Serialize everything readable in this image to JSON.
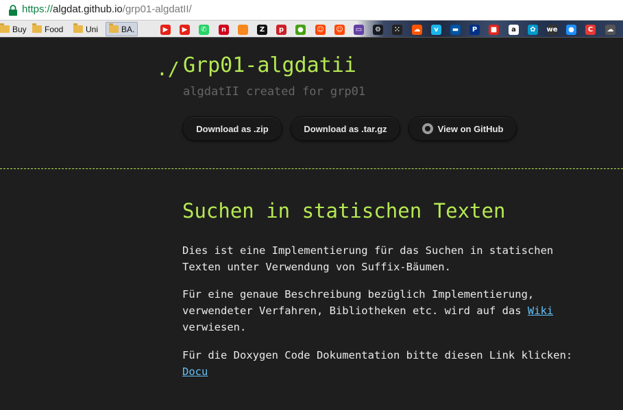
{
  "browser": {
    "url_protocol": "https://",
    "url_host": "algdat.github.io",
    "url_path": "/grp01-algdatII/",
    "bookmarks": [
      {
        "label": "Buy"
      },
      {
        "label": "Food"
      },
      {
        "label": "Uni"
      },
      {
        "label": "BA."
      }
    ],
    "bookmark_icons": [
      {
        "name": "youtube-icon",
        "color": "#e62117",
        "glyph": "▶"
      },
      {
        "name": "youtube-icon",
        "color": "#e62117",
        "glyph": "▶"
      },
      {
        "name": "whatsapp-icon",
        "color": "#25d366",
        "glyph": "✆"
      },
      {
        "name": "n-icon",
        "color": "#d0021b",
        "glyph": "n"
      },
      {
        "name": "orange-square-icon",
        "color": "#f6881f",
        "glyph": ""
      },
      {
        "name": "z-icon",
        "color": "#111111",
        "glyph": "Z"
      },
      {
        "name": "pinterest-icon",
        "color": "#cb2027",
        "glyph": "p"
      },
      {
        "name": "green-dot-icon",
        "color": "#46a012",
        "glyph": "●"
      },
      {
        "name": "reddit-icon",
        "color": "#ff4500",
        "glyph": "☺"
      },
      {
        "name": "reddit-icon",
        "color": "#ff4500",
        "glyph": "☺"
      },
      {
        "name": "twitch-icon",
        "color": "#6441a5",
        "glyph": "▭"
      },
      {
        "name": "steam-icon",
        "color": "#171a21",
        "glyph": "⚙"
      },
      {
        "name": "dots-icon",
        "color": "#222222",
        "glyph": "⁙"
      },
      {
        "name": "soundcloud-icon",
        "color": "#ff5500",
        "glyph": "☁"
      },
      {
        "name": "vimeo-icon",
        "color": "#1ab7ea",
        "glyph": "v"
      },
      {
        "name": "bank-icon",
        "color": "#0054a6",
        "glyph": "▬"
      },
      {
        "name": "paypal-icon",
        "color": "#003087",
        "glyph": "P"
      },
      {
        "name": "colorful-icon",
        "color": "#e1251b",
        "glyph": "■"
      },
      {
        "name": "amazon-icon",
        "color": "#ffffff",
        "glyph": "a"
      },
      {
        "name": "clover-icon",
        "color": "#0099cc",
        "glyph": "✿"
      },
      {
        "name": "we-icon",
        "color": "#333333",
        "glyph": "we"
      },
      {
        "name": "cloud-icon",
        "color": "#1e90ff",
        "glyph": "●"
      },
      {
        "name": "c-icon",
        "color": "#e53935",
        "glyph": "C"
      },
      {
        "name": "cloud-icon",
        "color": "#555555",
        "glyph": "☁"
      }
    ]
  },
  "header": {
    "prefix": "./",
    "title": "Grp01-algdatii",
    "subtitle": "algdatII created for grp01",
    "buttons": {
      "zip": "Download as .zip",
      "targz": "Download as .tar.gz",
      "github": "View on GitHub"
    }
  },
  "content": {
    "heading": "Suchen in statischen Texten",
    "p1": "Dies ist eine Implementierung für das Suchen in statischen Texten unter Verwendung von Suffix-Bäumen.",
    "p2_before": "Für eine genaue Beschreibung bezüglich Implementierung, verwendeter Verfahren, Bibliotheken etc. wird auf das ",
    "p2_link": "Wiki",
    "p2_after": " verwiesen.",
    "p3_before": "Für die Doxygen Code Dokumentation bitte diesen Link klicken: ",
    "p3_link": "Docu"
  },
  "colors": {
    "accent": "#b5e853",
    "link": "#63c0f5",
    "background": "#1e1e1e"
  }
}
